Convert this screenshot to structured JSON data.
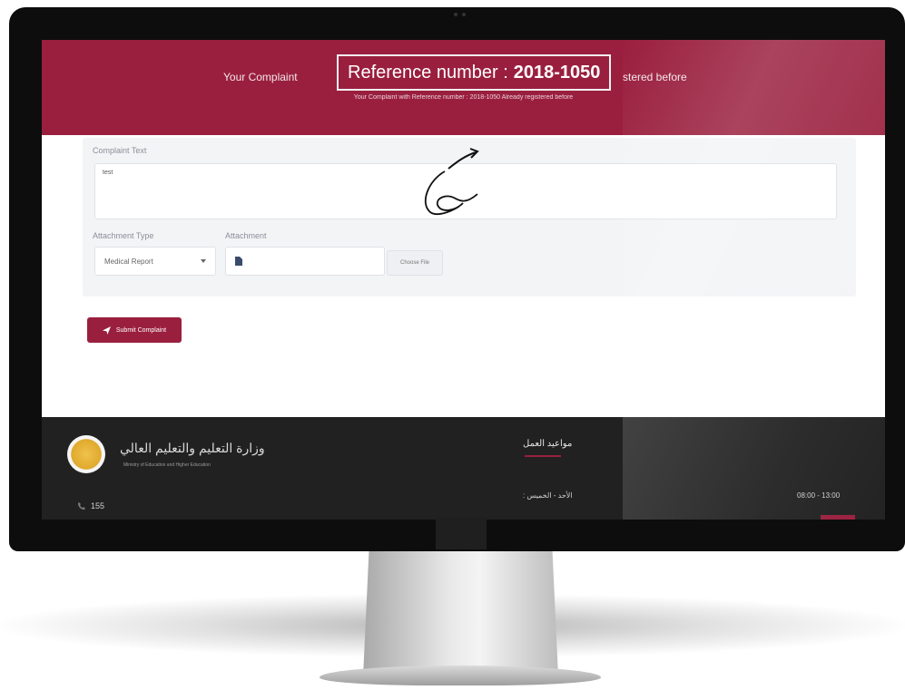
{
  "banner": {
    "callout_label": "Reference number :",
    "callout_number": "2018-1050",
    "line_left": "Your Complaint",
    "line_right": "stered before",
    "sub_line": "Your Complaint with Reference number : 2018-1050 Already registered before"
  },
  "annotation": {
    "step": "6"
  },
  "form": {
    "complaint_text_label": "Complaint Text",
    "complaint_text_value": "test",
    "attachment_type_label": "Attachment Type",
    "attachment_type_value": "Medical Report",
    "attachment_label": "Attachment",
    "choose_file_label": "Choose File",
    "submit_label": "Submit Complaint"
  },
  "footer": {
    "ministry_name_ar": "وزارة التعليم والتعليم العالي",
    "ministry_name_en": "Ministry of Education and Higher Education",
    "phone": "155",
    "hours_title": "مواعيد العمل",
    "days": "الأحد - الخميس :",
    "hours": "08:00 - 13:00"
  },
  "colors": {
    "brand": "#9a1f3e",
    "footer_bg": "#212121",
    "panel_bg": "#f3f4f6"
  }
}
